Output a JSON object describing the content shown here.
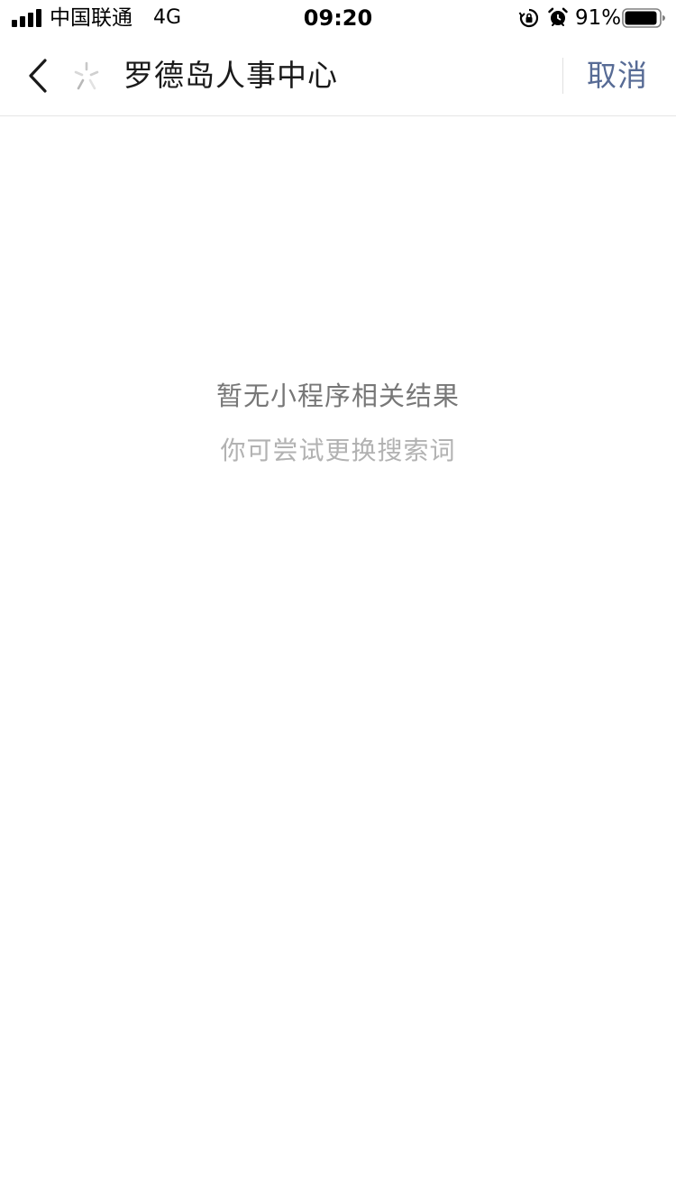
{
  "status_bar": {
    "carrier": "中国联通",
    "network": "4G",
    "time": "09:20",
    "battery_percent": "91%",
    "icons": [
      "signal-icon",
      "rotate-lock-icon",
      "alarm-icon",
      "battery-icon"
    ]
  },
  "header": {
    "back_icon": "chevron-left-icon",
    "loading_icon": "spinner-icon",
    "search_query": "罗德岛人事中心",
    "cancel_label": "取消"
  },
  "empty_state": {
    "title": "暂无小程序相关结果",
    "hint": "你可尝试更换搜索词"
  },
  "colors": {
    "accent": "#576b95",
    "title_text": "#777777",
    "hint_text": "#b2b2b2",
    "divider": "#e5e5e5"
  }
}
